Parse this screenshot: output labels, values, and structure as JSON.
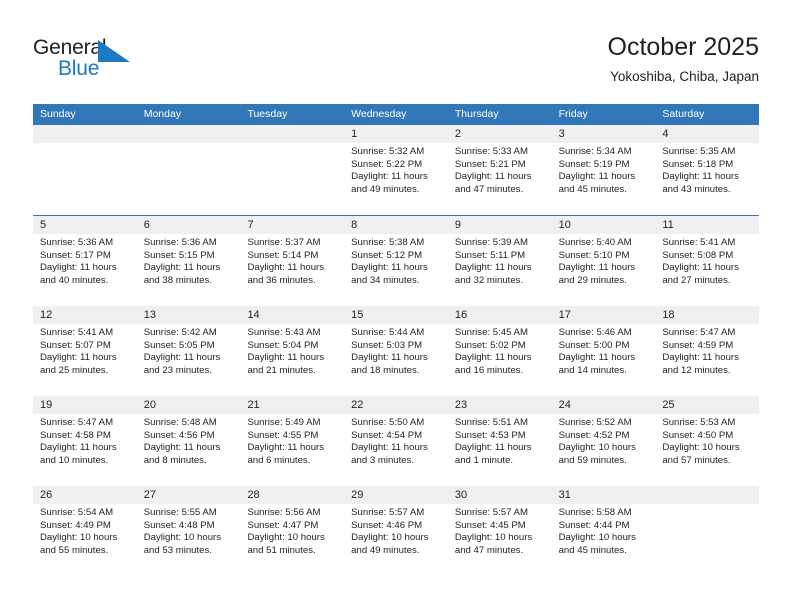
{
  "brand": {
    "name_part1": "General",
    "name_part2": "Blue",
    "triangle_icon": "triangle-icon",
    "color_dark": "#231f20",
    "color_blue": "#1b7ac4"
  },
  "header": {
    "title": "October 2025",
    "subtitle": "Yokoshiba, Chiba, Japan"
  },
  "theme": {
    "header_blue": "#3277b7",
    "day_band_gray": "#f0f0f0",
    "text": "#231f20"
  },
  "calendar": {
    "weekday_headers": [
      "Sunday",
      "Monday",
      "Tuesday",
      "Wednesday",
      "Thursday",
      "Friday",
      "Saturday"
    ],
    "labels": {
      "sunrise": "Sunrise:",
      "sunset": "Sunset:",
      "daylight": "Daylight:"
    },
    "weeks": [
      [
        {
          "day": "",
          "empty": true
        },
        {
          "day": "",
          "empty": true
        },
        {
          "day": "",
          "empty": true
        },
        {
          "day": "1",
          "sunrise": "Sunrise: 5:32 AM",
          "sunset": "Sunset: 5:22 PM",
          "daylight_1": "Daylight: 11 hours",
          "daylight_2": "and 49 minutes."
        },
        {
          "day": "2",
          "sunrise": "Sunrise: 5:33 AM",
          "sunset": "Sunset: 5:21 PM",
          "daylight_1": "Daylight: 11 hours",
          "daylight_2": "and 47 minutes."
        },
        {
          "day": "3",
          "sunrise": "Sunrise: 5:34 AM",
          "sunset": "Sunset: 5:19 PM",
          "daylight_1": "Daylight: 11 hours",
          "daylight_2": "and 45 minutes."
        },
        {
          "day": "4",
          "sunrise": "Sunrise: 5:35 AM",
          "sunset": "Sunset: 5:18 PM",
          "daylight_1": "Daylight: 11 hours",
          "daylight_2": "and 43 minutes."
        }
      ],
      [
        {
          "day": "5",
          "sunrise": "Sunrise: 5:36 AM",
          "sunset": "Sunset: 5:17 PM",
          "daylight_1": "Daylight: 11 hours",
          "daylight_2": "and 40 minutes."
        },
        {
          "day": "6",
          "sunrise": "Sunrise: 5:36 AM",
          "sunset": "Sunset: 5:15 PM",
          "daylight_1": "Daylight: 11 hours",
          "daylight_2": "and 38 minutes."
        },
        {
          "day": "7",
          "sunrise": "Sunrise: 5:37 AM",
          "sunset": "Sunset: 5:14 PM",
          "daylight_1": "Daylight: 11 hours",
          "daylight_2": "and 36 minutes."
        },
        {
          "day": "8",
          "sunrise": "Sunrise: 5:38 AM",
          "sunset": "Sunset: 5:12 PM",
          "daylight_1": "Daylight: 11 hours",
          "daylight_2": "and 34 minutes."
        },
        {
          "day": "9",
          "sunrise": "Sunrise: 5:39 AM",
          "sunset": "Sunset: 5:11 PM",
          "daylight_1": "Daylight: 11 hours",
          "daylight_2": "and 32 minutes."
        },
        {
          "day": "10",
          "sunrise": "Sunrise: 5:40 AM",
          "sunset": "Sunset: 5:10 PM",
          "daylight_1": "Daylight: 11 hours",
          "daylight_2": "and 29 minutes."
        },
        {
          "day": "11",
          "sunrise": "Sunrise: 5:41 AM",
          "sunset": "Sunset: 5:08 PM",
          "daylight_1": "Daylight: 11 hours",
          "daylight_2": "and 27 minutes."
        }
      ],
      [
        {
          "day": "12",
          "sunrise": "Sunrise: 5:41 AM",
          "sunset": "Sunset: 5:07 PM",
          "daylight_1": "Daylight: 11 hours",
          "daylight_2": "and 25 minutes."
        },
        {
          "day": "13",
          "sunrise": "Sunrise: 5:42 AM",
          "sunset": "Sunset: 5:05 PM",
          "daylight_1": "Daylight: 11 hours",
          "daylight_2": "and 23 minutes."
        },
        {
          "day": "14",
          "sunrise": "Sunrise: 5:43 AM",
          "sunset": "Sunset: 5:04 PM",
          "daylight_1": "Daylight: 11 hours",
          "daylight_2": "and 21 minutes."
        },
        {
          "day": "15",
          "sunrise": "Sunrise: 5:44 AM",
          "sunset": "Sunset: 5:03 PM",
          "daylight_1": "Daylight: 11 hours",
          "daylight_2": "and 18 minutes."
        },
        {
          "day": "16",
          "sunrise": "Sunrise: 5:45 AM",
          "sunset": "Sunset: 5:02 PM",
          "daylight_1": "Daylight: 11 hours",
          "daylight_2": "and 16 minutes."
        },
        {
          "day": "17",
          "sunrise": "Sunrise: 5:46 AM",
          "sunset": "Sunset: 5:00 PM",
          "daylight_1": "Daylight: 11 hours",
          "daylight_2": "and 14 minutes."
        },
        {
          "day": "18",
          "sunrise": "Sunrise: 5:47 AM",
          "sunset": "Sunset: 4:59 PM",
          "daylight_1": "Daylight: 11 hours",
          "daylight_2": "and 12 minutes."
        }
      ],
      [
        {
          "day": "19",
          "sunrise": "Sunrise: 5:47 AM",
          "sunset": "Sunset: 4:58 PM",
          "daylight_1": "Daylight: 11 hours",
          "daylight_2": "and 10 minutes."
        },
        {
          "day": "20",
          "sunrise": "Sunrise: 5:48 AM",
          "sunset": "Sunset: 4:56 PM",
          "daylight_1": "Daylight: 11 hours",
          "daylight_2": "and 8 minutes."
        },
        {
          "day": "21",
          "sunrise": "Sunrise: 5:49 AM",
          "sunset": "Sunset: 4:55 PM",
          "daylight_1": "Daylight: 11 hours",
          "daylight_2": "and 6 minutes."
        },
        {
          "day": "22",
          "sunrise": "Sunrise: 5:50 AM",
          "sunset": "Sunset: 4:54 PM",
          "daylight_1": "Daylight: 11 hours",
          "daylight_2": "and 3 minutes."
        },
        {
          "day": "23",
          "sunrise": "Sunrise: 5:51 AM",
          "sunset": "Sunset: 4:53 PM",
          "daylight_1": "Daylight: 11 hours",
          "daylight_2": "and 1 minute."
        },
        {
          "day": "24",
          "sunrise": "Sunrise: 5:52 AM",
          "sunset": "Sunset: 4:52 PM",
          "daylight_1": "Daylight: 10 hours",
          "daylight_2": "and 59 minutes."
        },
        {
          "day": "25",
          "sunrise": "Sunrise: 5:53 AM",
          "sunset": "Sunset: 4:50 PM",
          "daylight_1": "Daylight: 10 hours",
          "daylight_2": "and 57 minutes."
        }
      ],
      [
        {
          "day": "26",
          "sunrise": "Sunrise: 5:54 AM",
          "sunset": "Sunset: 4:49 PM",
          "daylight_1": "Daylight: 10 hours",
          "daylight_2": "and 55 minutes."
        },
        {
          "day": "27",
          "sunrise": "Sunrise: 5:55 AM",
          "sunset": "Sunset: 4:48 PM",
          "daylight_1": "Daylight: 10 hours",
          "daylight_2": "and 53 minutes."
        },
        {
          "day": "28",
          "sunrise": "Sunrise: 5:56 AM",
          "sunset": "Sunset: 4:47 PM",
          "daylight_1": "Daylight: 10 hours",
          "daylight_2": "and 51 minutes."
        },
        {
          "day": "29",
          "sunrise": "Sunrise: 5:57 AM",
          "sunset": "Sunset: 4:46 PM",
          "daylight_1": "Daylight: 10 hours",
          "daylight_2": "and 49 minutes."
        },
        {
          "day": "30",
          "sunrise": "Sunrise: 5:57 AM",
          "sunset": "Sunset: 4:45 PM",
          "daylight_1": "Daylight: 10 hours",
          "daylight_2": "and 47 minutes."
        },
        {
          "day": "31",
          "sunrise": "Sunrise: 5:58 AM",
          "sunset": "Sunset: 4:44 PM",
          "daylight_1": "Daylight: 10 hours",
          "daylight_2": "and 45 minutes."
        },
        {
          "day": "",
          "empty": true
        }
      ]
    ]
  }
}
